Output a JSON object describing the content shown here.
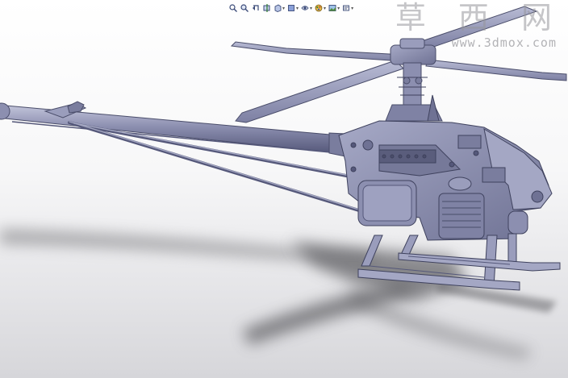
{
  "app": {
    "name": "CAD model viewport"
  },
  "heads_up_toolbar": {
    "items": [
      {
        "name": "zoom-to-fit-icon"
      },
      {
        "name": "zoom-to-area-icon"
      },
      {
        "name": "previous-view-icon"
      },
      {
        "name": "section-view-icon"
      },
      {
        "name": "view-orientation-icon",
        "has_dropdown": true
      },
      {
        "name": "display-style-icon",
        "has_dropdown": true
      },
      {
        "name": "hide-show-items-icon",
        "has_dropdown": true
      },
      {
        "name": "edit-appearance-icon",
        "has_dropdown": true
      },
      {
        "name": "apply-scene-icon",
        "has_dropdown": true
      },
      {
        "name": "view-settings-icon",
        "has_dropdown": true
      }
    ]
  },
  "watermark": {
    "title": "草 西 网",
    "url": "www.3dmox.com"
  },
  "model": {
    "subject": "RC helicopter assembly",
    "colors": {
      "body": "#8c8fb0",
      "body_dark": "#4a4d6a",
      "body_light": "#b4b7d0",
      "shadow": "#6e6e73"
    }
  }
}
